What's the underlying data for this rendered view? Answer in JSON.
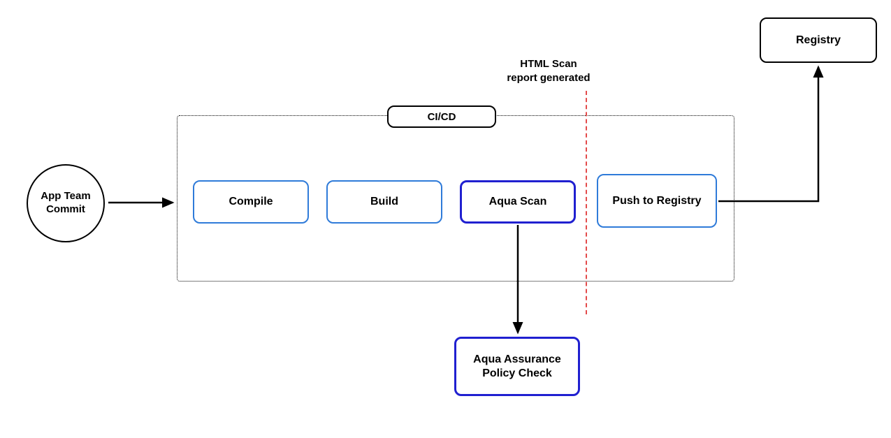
{
  "start": {
    "label": "App Team\nCommit"
  },
  "cicd": {
    "label": "CI/CD",
    "stages": {
      "compile": "Compile",
      "build": "Build",
      "scan": "Aqua Scan",
      "push": "Push to Registry"
    }
  },
  "annotation": {
    "html_scan": "HTML Scan\nreport generated"
  },
  "policy": {
    "label": "Aqua Assurance\nPolicy Check"
  },
  "registry": {
    "label": "Registry"
  }
}
